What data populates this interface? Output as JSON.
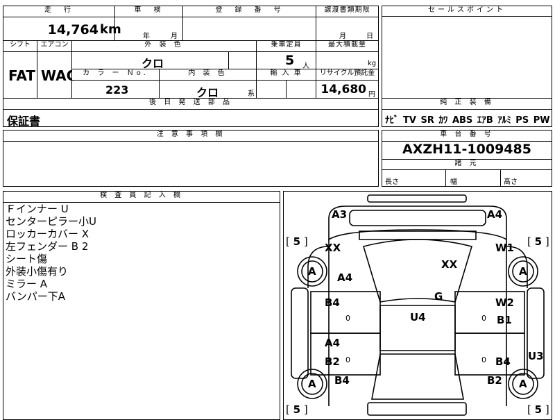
{
  "top_fragment": "",
  "mileage": {
    "label": "走　行",
    "value": "14,764",
    "unit": "km"
  },
  "inspection": {
    "label": "車　検",
    "year_unit": "年",
    "month_unit": "月"
  },
  "registration": {
    "label": "登　録　番　号"
  },
  "transfer": {
    "label": "譲渡書類期限",
    "month_unit": "月",
    "day_unit": "日"
  },
  "sales_point": {
    "label": "セールスポイント"
  },
  "shift": {
    "label": "シフト",
    "value": "FAT"
  },
  "aircon": {
    "label": "エアコン",
    "value": "WAC"
  },
  "exterior_color": {
    "label": "外 装 色",
    "value": "クロ"
  },
  "capacity": {
    "label": "乗車定員",
    "value": "5",
    "unit": "人"
  },
  "max_load": {
    "label": "最大積載量",
    "unit": "kg"
  },
  "color_no": {
    "label": "カ ラ ー Ｎo.",
    "value": "223"
  },
  "interior_color": {
    "label": "内 装 色",
    "value": "クロ",
    "suffix": "系"
  },
  "import": {
    "label": "輸 入 車"
  },
  "recycle": {
    "label": "リサイクル預託金",
    "value": "14,680",
    "unit": "円"
  },
  "later_parts": {
    "label": "後 日 発 送 部 品",
    "value": "保証書"
  },
  "genuine_equipment": {
    "label": "純 正 装 備",
    "items": [
      "ﾅﾋﾞ",
      "TV",
      "SR",
      "ｶﾜ",
      "ABS",
      "ｴｱB",
      "ｱﾙﾐ",
      "PS",
      "PW"
    ]
  },
  "notes": {
    "label": "注 意 事 項 欄"
  },
  "chassis": {
    "label": "車 台 番 号",
    "value": "AXZH11-1009485"
  },
  "dimensions": {
    "label": "諸 元",
    "length": "長さ",
    "width": "幅",
    "height": "高さ"
  },
  "inspector": {
    "label": "検 査 員 記 入 欄",
    "lines": [
      "Ｆインナー U",
      "センターピラー小U",
      "ロッカーカバー X",
      "左フェンダー B 2",
      "シート傷",
      "外装小傷有り",
      "ミラー A",
      "バンパー下A"
    ]
  },
  "diagram": {
    "tyre_left_top": "5",
    "tyre_right_top": "5",
    "tyre_left_bottom": "5",
    "tyre_right_bottom": "5",
    "labels": {
      "a3": "A3",
      "a4_tr": "A4",
      "xx_l": "XX",
      "w1": "W1",
      "xx_c": "XX",
      "a4_l": "A4",
      "g": "G",
      "b4_l1": "B4",
      "w2": "W2",
      "u4": "U4",
      "b1": "B1",
      "a4_l2": "A4",
      "b2_l": "B2",
      "b4_r": "B4",
      "u3": "U3",
      "b4_l3": "B4",
      "b2_r": "B2",
      "wheel": "A",
      "zero": "0"
    }
  }
}
